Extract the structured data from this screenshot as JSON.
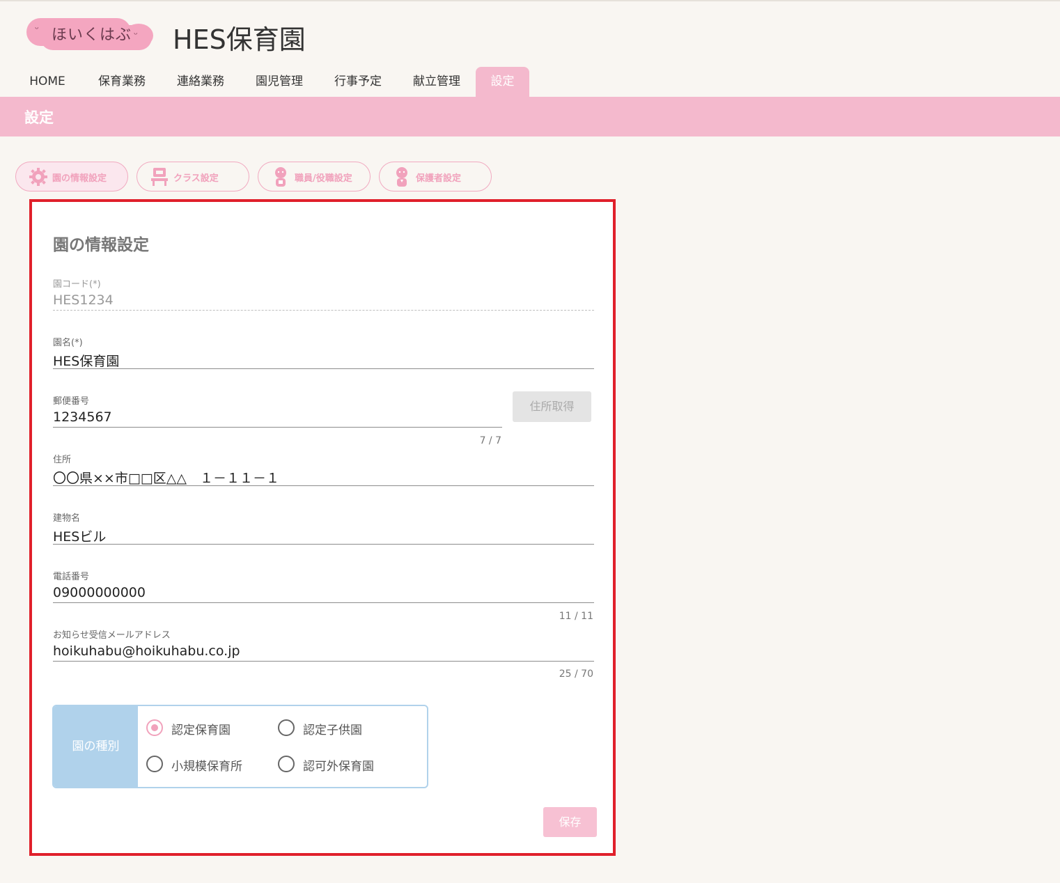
{
  "header": {
    "logo_text": "ほいくはぶ",
    "app_title": "HES保育園"
  },
  "nav": {
    "items": [
      {
        "label": "HOME"
      },
      {
        "label": "保育業務"
      },
      {
        "label": "連絡業務"
      },
      {
        "label": "園児管理"
      },
      {
        "label": "行事予定"
      },
      {
        "label": "献立管理"
      },
      {
        "label": "設定",
        "active": true
      }
    ]
  },
  "page": {
    "title": "設定"
  },
  "subtabs": [
    {
      "label": "園の情報設定",
      "icon": "gear-icon",
      "active": true
    },
    {
      "label": "クラス設定",
      "icon": "classroom-icon"
    },
    {
      "label": "職員/役職設定",
      "icon": "staff-icon"
    },
    {
      "label": "保護者設定",
      "icon": "guardian-icon"
    }
  ],
  "form": {
    "title": "園の情報設定",
    "school_code": {
      "label": "園コード(*)",
      "value": "HES1234"
    },
    "school_name": {
      "label": "園名(*)",
      "value": "HES保育園"
    },
    "postal_code": {
      "label": "郵便番号",
      "value": "1234567",
      "counter": "7 / 7"
    },
    "address_button": "住所取得",
    "address": {
      "label": "住所",
      "value": "〇〇県××市□□区△△　１－１１－１"
    },
    "building": {
      "label": "建物名",
      "value": "HESビル"
    },
    "phone": {
      "label": "電話番号",
      "value": "09000000000",
      "counter": "11 / 11"
    },
    "email": {
      "label": "お知らせ受信メールアドレス",
      "value": "hoikuhabu@hoikuhabu.co.jp",
      "counter": "25 / 70"
    },
    "type": {
      "label": "園の種別",
      "options": [
        {
          "label": "認定保育園",
          "checked": true
        },
        {
          "label": "認定子供園"
        },
        {
          "label": "小規模保育所"
        },
        {
          "label": "認可外保育園"
        }
      ]
    },
    "save_button": "保存"
  },
  "colors": {
    "accent_pink": "#f4b9cd",
    "type_blue": "#b0d2eb",
    "highlight_red": "#e0202b"
  }
}
